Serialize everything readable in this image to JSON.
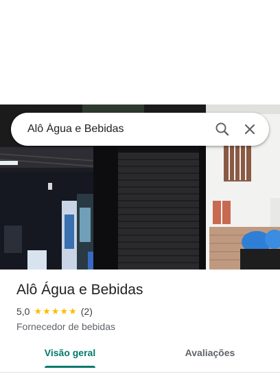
{
  "search": {
    "query": "Alô Água e Bebidas",
    "search_icon": "search-icon",
    "close_icon": "close-icon"
  },
  "place": {
    "name": "Alô Água e Bebidas",
    "rating": "5,0",
    "rating_stars": 5,
    "review_count": "(2)",
    "category": "Fornecedor de bebidas"
  },
  "tabs": [
    {
      "label": "Visão geral",
      "active": true
    },
    {
      "label": "Avaliações",
      "active": false
    }
  ],
  "colors": {
    "accent": "#00796b",
    "star": "#fbbc04"
  }
}
